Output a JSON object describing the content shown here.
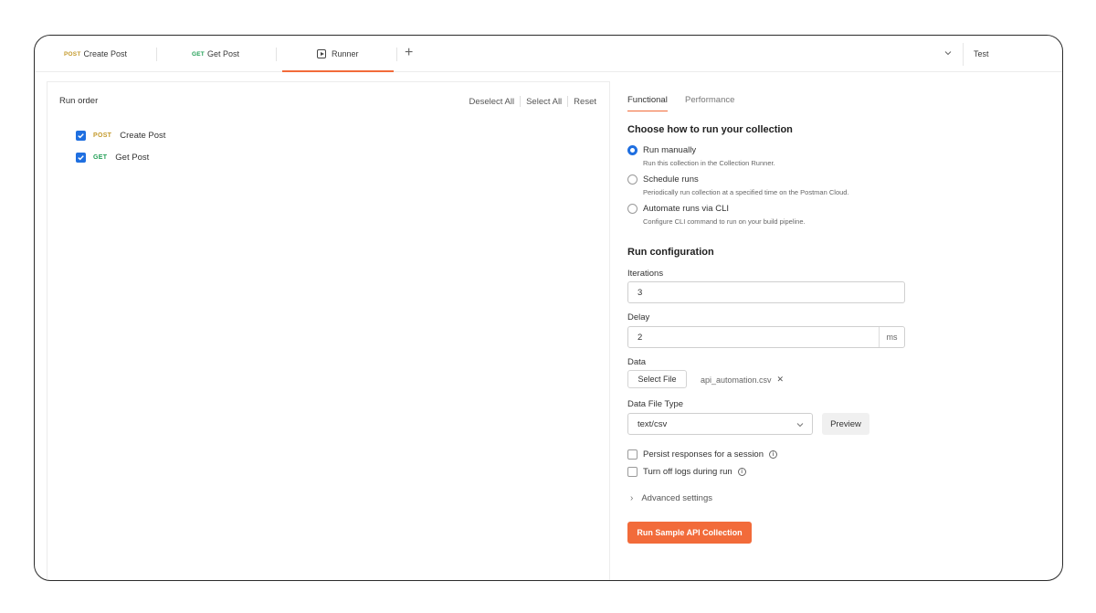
{
  "tabs": [
    {
      "method": "POST",
      "label": "Create Post"
    },
    {
      "method": "GET",
      "label": "Get Post"
    },
    {
      "method": "",
      "label": "Runner"
    }
  ],
  "environment": {
    "name": "Test"
  },
  "run_order": {
    "title": "Run order",
    "actions": {
      "deselect_all": "Deselect All",
      "select_all": "Select All",
      "reset": "Reset"
    },
    "requests": [
      {
        "method": "POST",
        "name": "Create Post",
        "checked": true
      },
      {
        "method": "GET",
        "name": "Get Post",
        "checked": true
      }
    ]
  },
  "config": {
    "tabs": {
      "functional": "Functional",
      "performance": "Performance"
    },
    "choose_heading": "Choose how to run your collection",
    "options": [
      {
        "label": "Run manually",
        "desc": "Run this collection in the Collection Runner.",
        "selected": true
      },
      {
        "label": "Schedule runs",
        "desc": "Periodically run collection at a specified time on the Postman Cloud.",
        "selected": false
      },
      {
        "label": "Automate runs via CLI",
        "desc": "Configure CLI command to run on your build pipeline.",
        "selected": false
      }
    ],
    "run_config_heading": "Run configuration",
    "iterations_label": "Iterations",
    "iterations_value": "3",
    "delay_label": "Delay",
    "delay_value": "2",
    "delay_unit": "ms",
    "data_label": "Data",
    "select_file_label": "Select File",
    "file_name": "api_automation.csv",
    "data_file_type_label": "Data File Type",
    "data_file_type_value": "text/csv",
    "preview_label": "Preview",
    "persist_label": "Persist responses for a session",
    "turn_off_logs_label": "Turn off logs during run",
    "advanced_label": "Advanced settings",
    "run_button_label": "Run Sample API Collection"
  },
  "colors": {
    "accent": "#f26b3a",
    "checkbox": "#1f6fe0",
    "post": "#c49a2c",
    "get": "#23a057"
  }
}
